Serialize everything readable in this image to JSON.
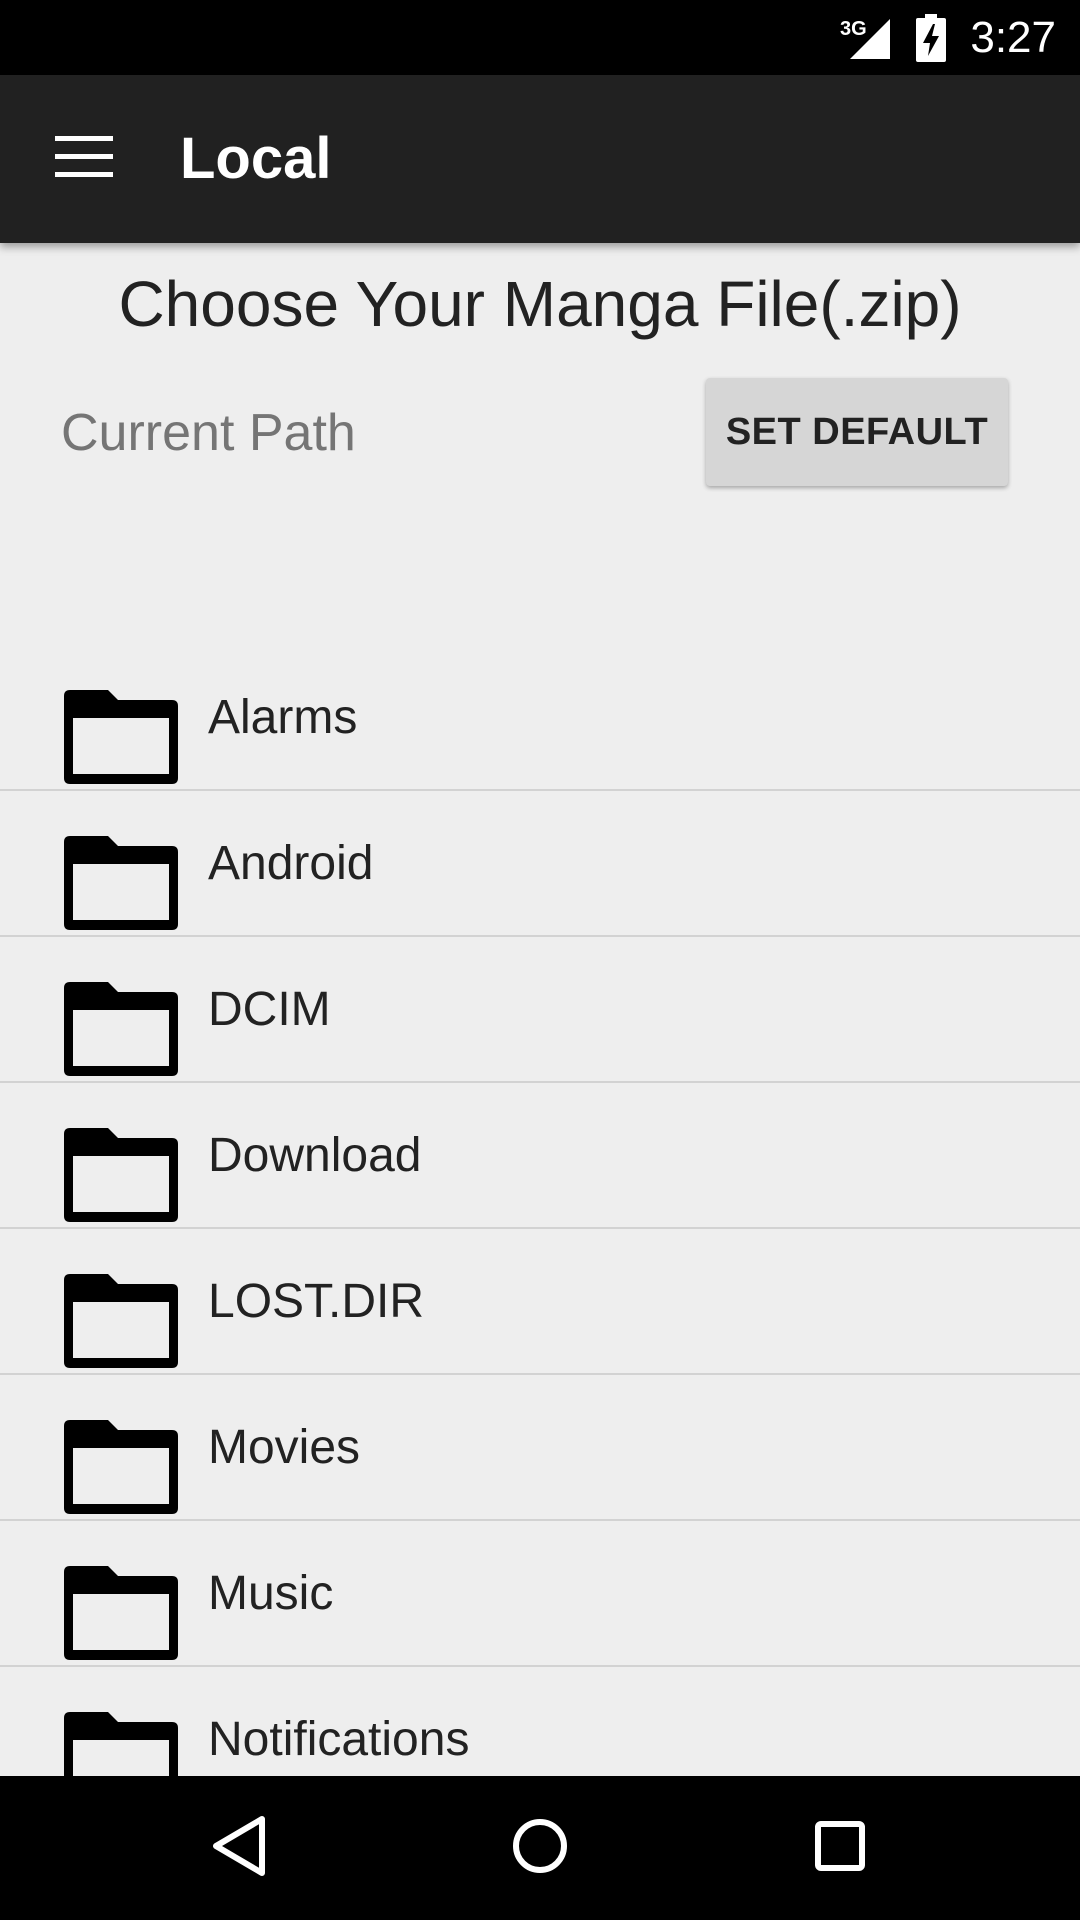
{
  "status_bar": {
    "network": "3G",
    "time": "3:27",
    "signal_icon": "signal-icon",
    "battery_icon": "battery-charging-icon"
  },
  "app_bar": {
    "title": "Local",
    "menu_icon": "hamburger-menu-icon"
  },
  "main": {
    "heading": "Choose Your Manga File(.zip)",
    "current_path_label": "Current Path",
    "set_default_label": "SET DEFAULT",
    "folders": [
      {
        "name": "Alarms"
      },
      {
        "name": "Android"
      },
      {
        "name": "DCIM"
      },
      {
        "name": "Download"
      },
      {
        "name": "LOST.DIR"
      },
      {
        "name": "Movies"
      },
      {
        "name": "Music"
      },
      {
        "name": "Notifications"
      }
    ]
  },
  "nav_bar": {
    "back_icon": "back-icon",
    "home_icon": "home-icon",
    "recents_icon": "recents-icon"
  },
  "colors": {
    "app_bar": "#212121",
    "background": "#eeeeee",
    "status_bar": "#000000"
  }
}
